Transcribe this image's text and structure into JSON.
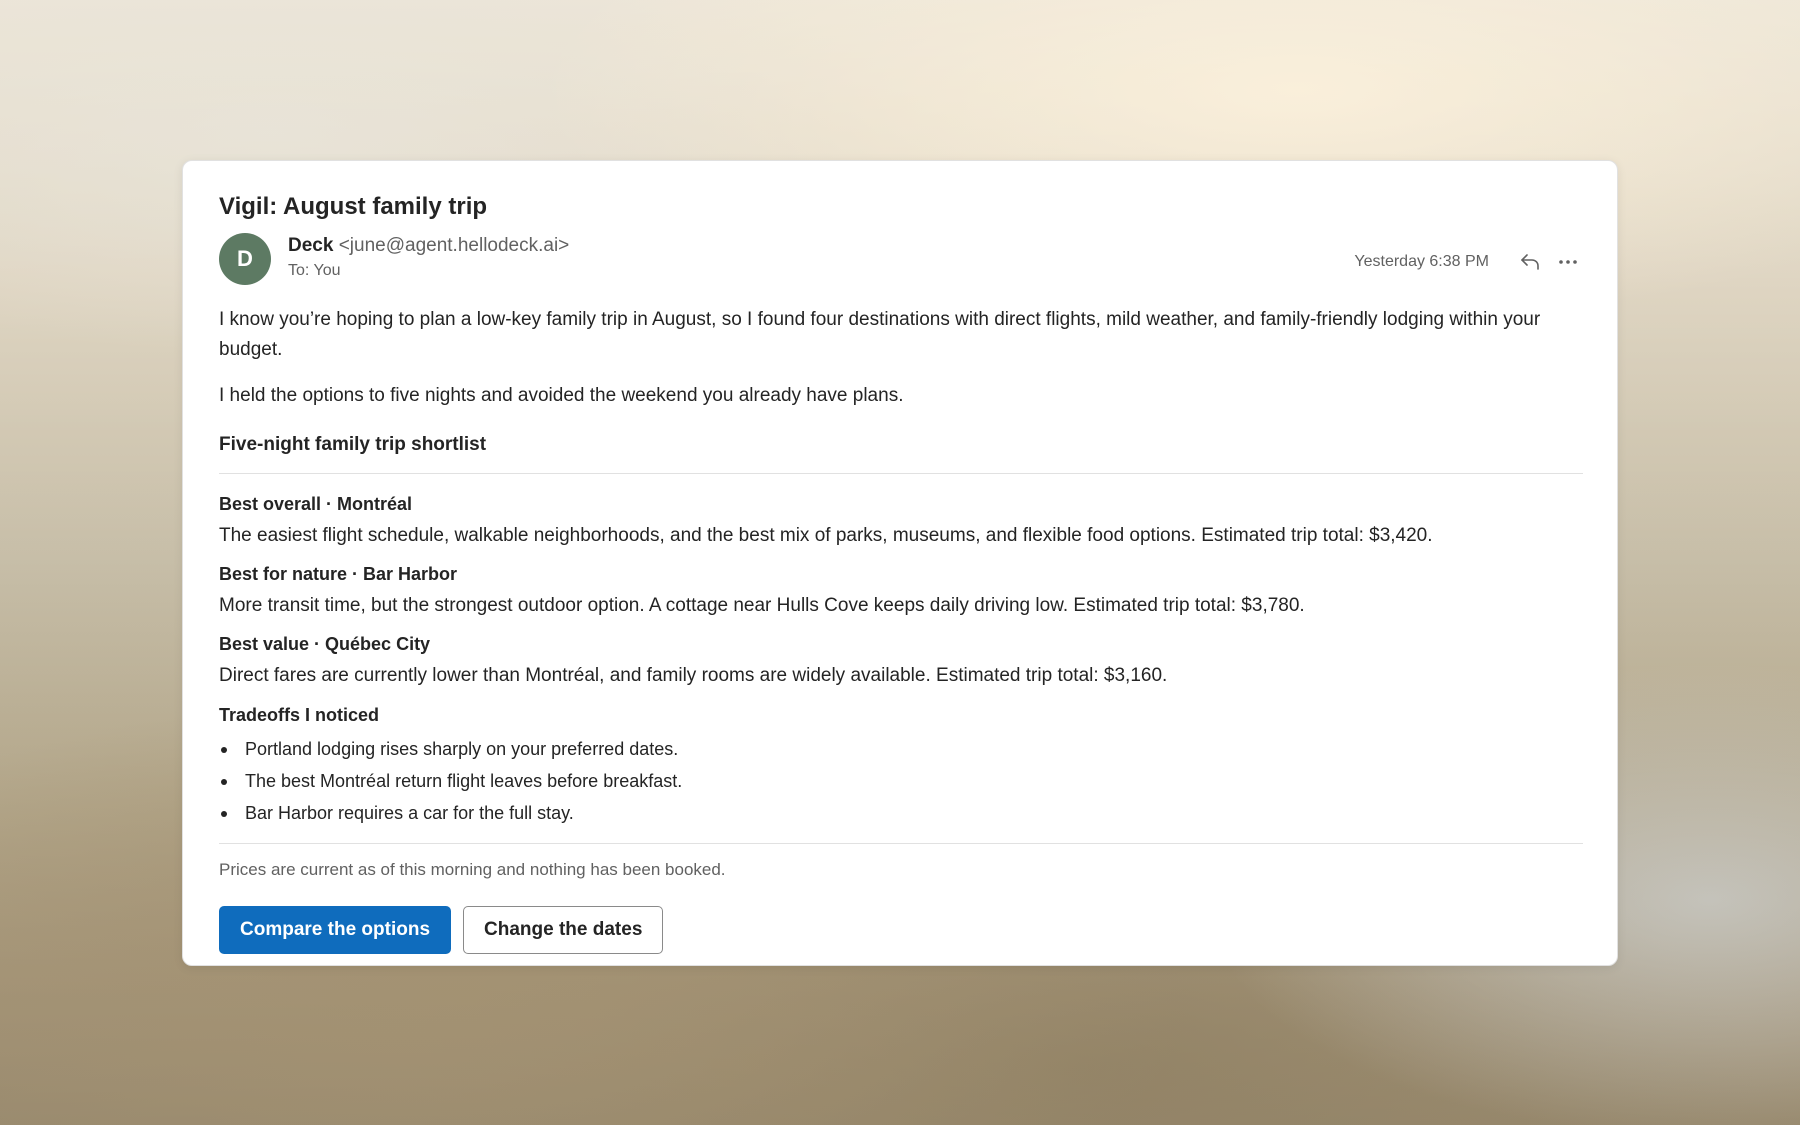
{
  "email": {
    "subject": "Vigil: August family trip",
    "sender": {
      "initial": "D",
      "name": "Deck",
      "email": "<june@agent.hellodeck.ai>",
      "avatar_color": "#5d7a63"
    },
    "to_line": "To: You",
    "timestamp": "Yesterday 6:38 PM",
    "icons": {
      "reply": "reply-icon",
      "more": "more-options-icon"
    },
    "paragraphs": [
      "I know you’re hoping to plan a low-key family trip in August, so I found four destinations with direct flights, mild weather, and family-friendly lodging within your budget.",
      "I held the options to five nights and avoided the weekend you already have plans."
    ],
    "shortlist_title": "Five-night family trip shortlist",
    "options": [
      {
        "label": "Best overall · Montréal",
        "description": "The easiest flight schedule, walkable neighborhoods, and the best mix of parks, museums, and flexible food options. Estimated trip total: $3,420."
      },
      {
        "label": "Best for nature · Bar Harbor",
        "description": "More transit time, but the strongest outdoor option. A cottage near Hulls Cove keeps daily driving low. Estimated trip total: $3,780."
      },
      {
        "label": "Best value · Québec City",
        "description": "Direct fares are currently lower than Montréal, and family rooms are widely available. Estimated trip total: $3,160."
      }
    ],
    "tradeoffs_title": "Tradeoffs I noticed",
    "tradeoffs": [
      "Portland lodging rises sharply on your preferred dates.",
      "The best Montréal return flight leaves before breakfast.",
      "Bar Harbor requires a car for the full stay."
    ],
    "footer_note": "Prices are current as of this morning and nothing has been booked.",
    "actions": {
      "primary": "Compare the options",
      "secondary": "Change the dates"
    },
    "colors": {
      "primary_button": "#0f6cbd",
      "muted_text": "#616161"
    }
  }
}
